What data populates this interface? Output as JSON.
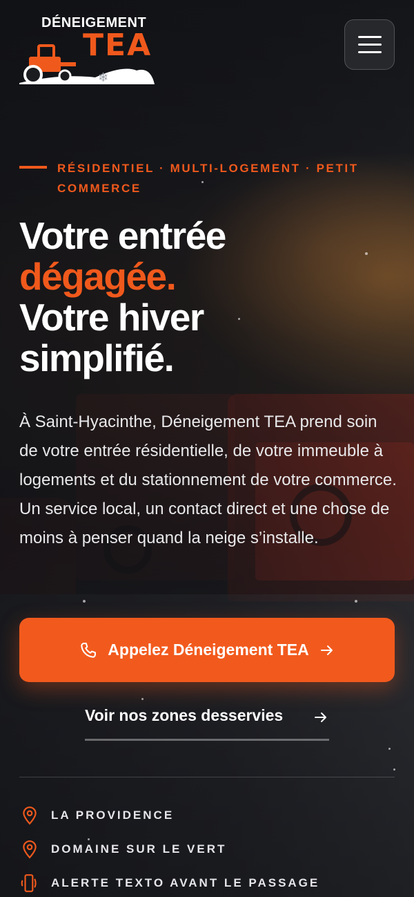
{
  "brand": {
    "logo_word": "DÉNEIGEMENT",
    "logo_accent": "TEA",
    "accent_color": "#f0591c"
  },
  "header": {
    "menu_icon": "hamburger-menu-icon"
  },
  "hero": {
    "eyebrow": "RÉSIDENTIEL · MULTI-LOGEMENT · PETIT COMMERCE",
    "headline_line1": "Votre entrée",
    "headline_accent": "dégagée.",
    "headline_line3": "Votre hiver",
    "headline_line4": "simplifié.",
    "lead": "À Saint-Hyacinthe, Déneigement TEA prend soin de votre entrée résidentielle, de votre immeuble à logements et du stationnement de votre commerce. Un service local, un contact direct et une chose de moins à penser quand la neige s’installe."
  },
  "actions": {
    "call_label": "Appelez Déneigement TEA",
    "zones_label": "Voir nos zones desservies"
  },
  "features": [
    {
      "label": "LA PROVIDENCE",
      "icon": "map-pin-icon"
    },
    {
      "label": "DOMAINE SUR LE VERT",
      "icon": "map-pin-icon"
    },
    {
      "label": "ALERTE TEXTO AVANT LE PASSAGE",
      "icon": "phone-vibrate-icon"
    }
  ]
}
